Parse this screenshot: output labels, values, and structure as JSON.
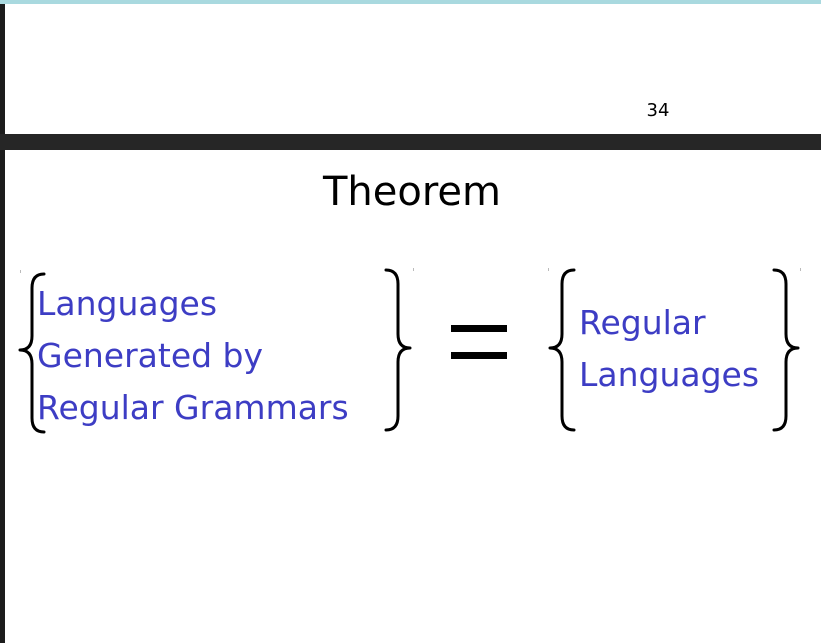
{
  "page": {
    "number": "34"
  },
  "slide": {
    "title": "Theorem",
    "left_set": {
      "lines": [
        "Languages",
        "Generated by",
        "Regular Grammars"
      ]
    },
    "right_set": {
      "lines": [
        "Regular",
        "Languages"
      ]
    }
  },
  "colors": {
    "set_text": "#3d3dc4",
    "divider": "#262626",
    "top_strip": "#a9d9df"
  }
}
